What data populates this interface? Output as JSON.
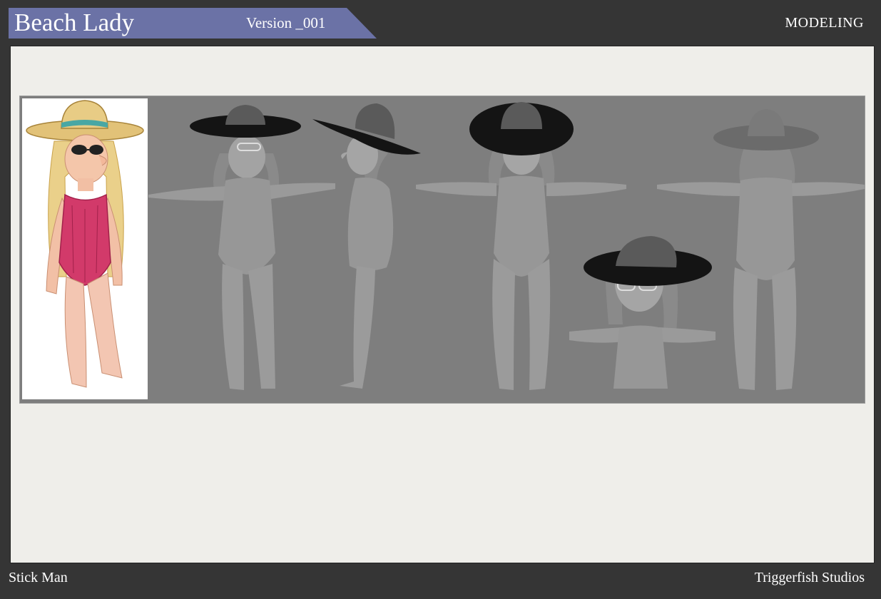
{
  "header": {
    "title": "Beach Lady",
    "version": "Version _001",
    "section": "MODELING"
  },
  "footer": {
    "project": "Stick Man",
    "studio": "Triggerfish Studios"
  },
  "colors": {
    "header_bar": "#353535",
    "title_tab": "#6b72a6",
    "sheet": "#efeeea",
    "render_background": "#7e7e7e",
    "model_grey": "#9a9a9a",
    "hat_dark": "#141414",
    "swimsuit": "#d23a6a",
    "hair": "#e9cf8a"
  },
  "views": [
    {
      "name": "concept-sketch-front"
    },
    {
      "name": "model-front-three-quarter"
    },
    {
      "name": "model-side"
    },
    {
      "name": "model-front"
    },
    {
      "name": "model-bust-closeup"
    },
    {
      "name": "model-back"
    }
  ]
}
